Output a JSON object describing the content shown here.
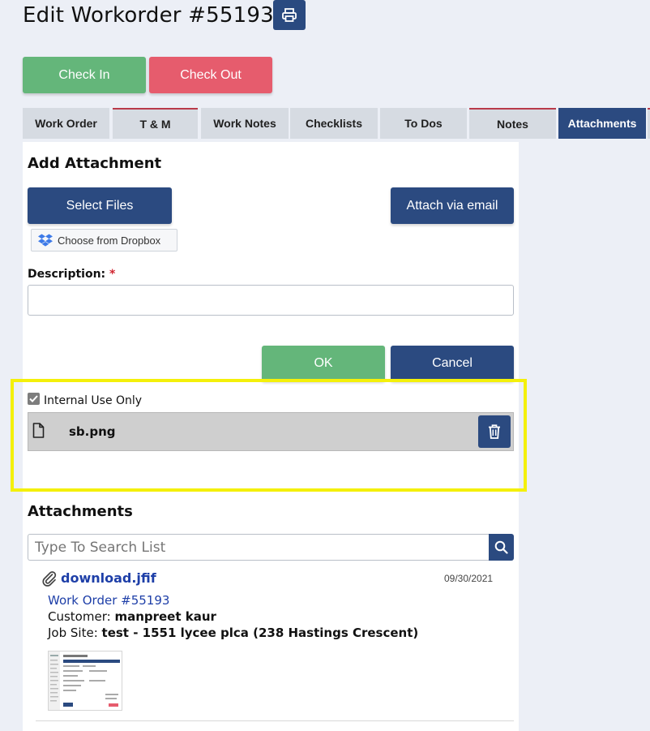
{
  "page": {
    "title": "Edit Workorder #55193",
    "print_icon": "printer-icon"
  },
  "actions": {
    "check_in": "Check In",
    "check_out": "Check Out"
  },
  "tabs": [
    {
      "label": "Work Order"
    },
    {
      "label": "T & M"
    },
    {
      "label": "Work Notes"
    },
    {
      "label": "Checklists"
    },
    {
      "label": "To Dos"
    },
    {
      "label": "Notes"
    },
    {
      "label": "Attachments",
      "active": true
    }
  ],
  "add_attachment": {
    "heading": "Add Attachment",
    "select_files": "Select Files",
    "attach_email": "Attach via email",
    "dropbox": "Choose from Dropbox",
    "description_label": "Description:",
    "required_mark": "*",
    "description_value": "",
    "ok": "OK",
    "cancel": "Cancel",
    "internal_use_label": "Internal Use Only",
    "internal_use_checked": true,
    "file_name": "sb.png"
  },
  "attachments": {
    "heading": "Attachments",
    "search_placeholder": "Type To Search List",
    "items": [
      {
        "file": "download.jfif",
        "date": "09/30/2021",
        "work_order": "Work Order #55193",
        "customer_label": "Customer:",
        "customer": "manpreet kaur",
        "jobsite_label": "Job Site:",
        "jobsite": "test - 1551 lycee plca (238 Hastings Crescent)"
      }
    ]
  },
  "colors": {
    "navy": "#2b4a80",
    "green": "#64b67a",
    "red": "#e65c6d",
    "highlight": "#f4f00a",
    "background": "#eceff6"
  }
}
